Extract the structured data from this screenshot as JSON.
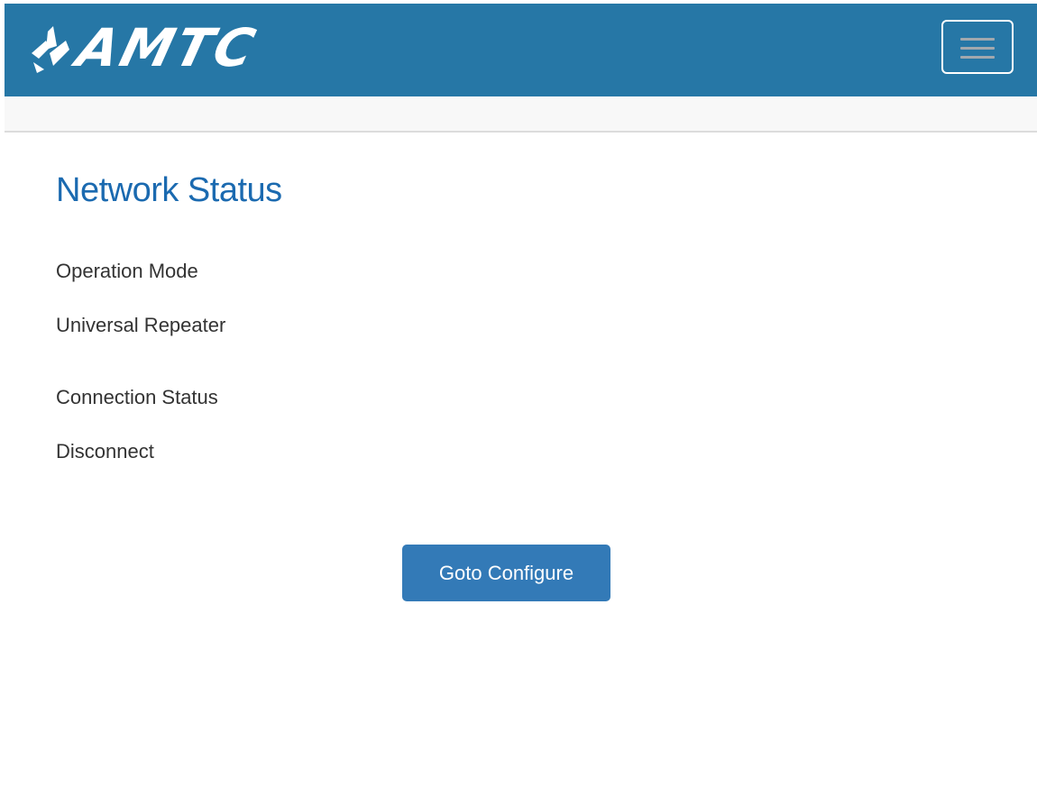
{
  "header": {
    "logo_text": "AMTC",
    "menu_toggle_icon": "hamburger-icon",
    "background_color": "#2677a6"
  },
  "main": {
    "title": "Network Status",
    "operation_mode": {
      "label": "Operation Mode",
      "value": "Universal Repeater"
    },
    "connection_status": {
      "label": "Connection Status",
      "value": "Disconnect"
    },
    "configure_button_label": "Goto Configure"
  },
  "colors": {
    "title": "#1b6ab0",
    "button": "#337ab7",
    "text": "#333333"
  }
}
